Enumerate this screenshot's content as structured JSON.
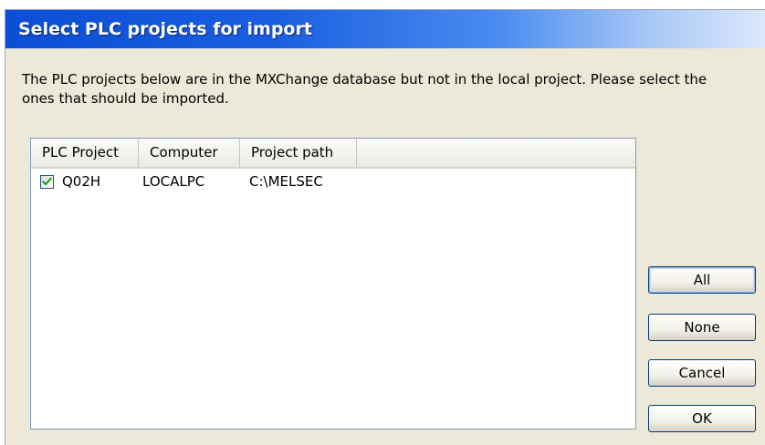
{
  "window": {
    "title": "Select PLC projects for import"
  },
  "description": "The PLC projects below are in the MXChange database but not in the local project. Please select the ones that should be imported.",
  "table": {
    "columns": [
      "PLC Project",
      "Computer",
      "Project path"
    ],
    "rows": [
      {
        "checked": true,
        "cells": [
          "Q02H",
          "LOCALPC",
          "C:\\MELSEC"
        ]
      }
    ]
  },
  "buttons": {
    "all": "All",
    "none": "None",
    "cancel": "Cancel",
    "ok": "OK"
  },
  "colors": {
    "title_bar": "#0a4fd4",
    "dialog_background": "#ece9d8",
    "button_border": "#003c74"
  }
}
